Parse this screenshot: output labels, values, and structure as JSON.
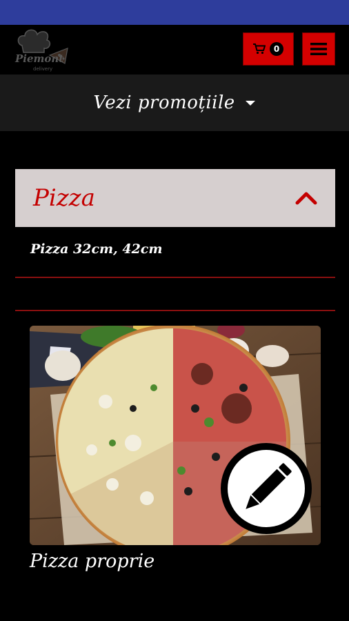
{
  "header": {
    "logo_text": "Piemont",
    "logo_subtext": "delivery",
    "cart_count": "0"
  },
  "promo": {
    "label": "Vezi promoțiile"
  },
  "category": {
    "title": "Pizza",
    "subtitle": "Pizza 32cm, 42cm"
  },
  "products": [
    {
      "name": "Pizza proprie"
    }
  ],
  "colors": {
    "status_bar": "#2e3d9c",
    "accent_red": "#d40000",
    "accordion_bg": "#d6cfcf",
    "background": "#000000"
  },
  "icons": [
    "cart-icon",
    "hamburger-menu-icon",
    "caret-down-icon",
    "chevron-up-icon",
    "pencil-edit-icon"
  ]
}
